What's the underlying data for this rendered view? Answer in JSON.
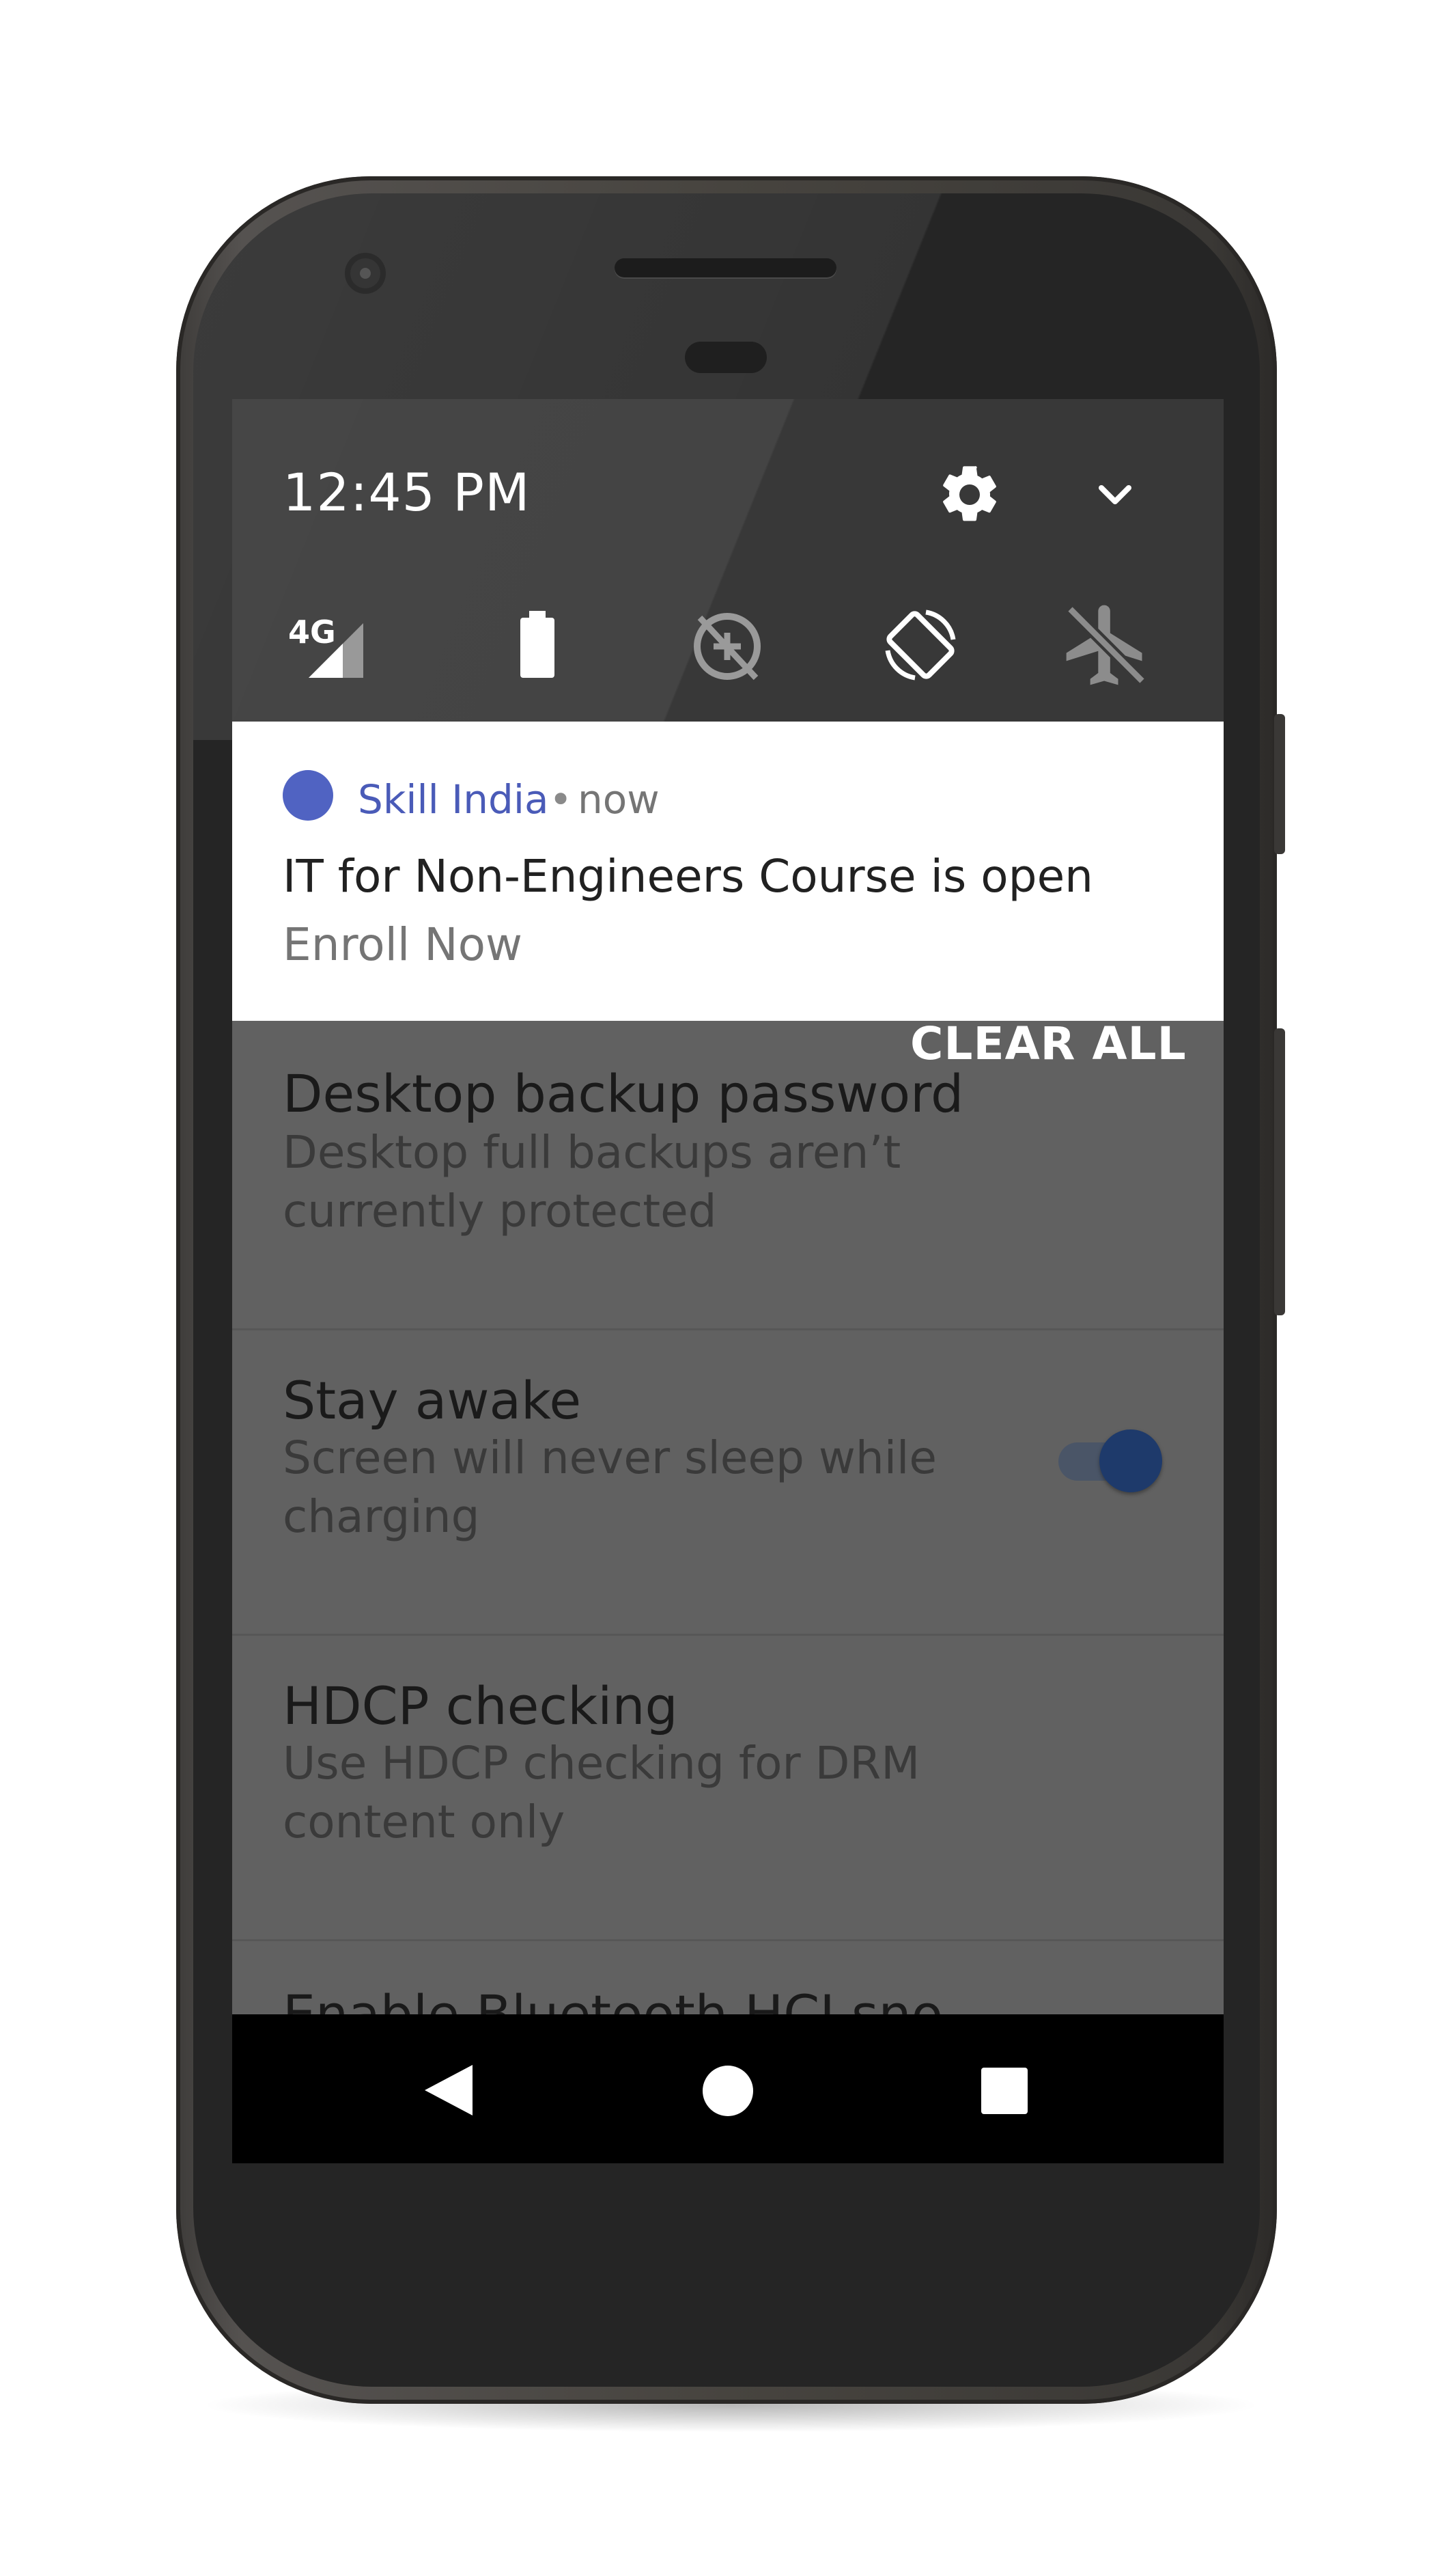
{
  "status": {
    "time": "12:45 PM",
    "network_type": "4G"
  },
  "icons": {
    "settings": "gear-icon",
    "expand": "chevron-down-icon",
    "signal": "signal-icon",
    "battery": "battery-icon",
    "data_saver": "data-saver-off-icon",
    "rotate": "auto-rotate-icon",
    "airplane": "airplane-icon",
    "app": "app-dot-icon",
    "back": "back-icon",
    "home": "home-icon",
    "recents": "recents-icon"
  },
  "notification": {
    "app_name": "Skill India",
    "separator": "•",
    "time": "now",
    "title": "IT for Non-Engineers Course is open",
    "text": "Enroll Now"
  },
  "clear_all_label": "CLEAR ALL",
  "settings_list": [
    {
      "title": "Desktop backup password",
      "subtitle": "Desktop full backups aren’t currently protected"
    },
    {
      "title": "Stay awake",
      "subtitle": "Screen will never sleep while charging",
      "toggle_on": true
    },
    {
      "title": "HDCP checking",
      "subtitle": "Use HDCP checking for DRM content only"
    },
    {
      "title": "Enable Bluetooth HCI sno"
    }
  ],
  "colors": {
    "accent": "#4a5bb8",
    "app_dot": "#5063c2",
    "toggle_thumb": "#1e3a6b"
  }
}
